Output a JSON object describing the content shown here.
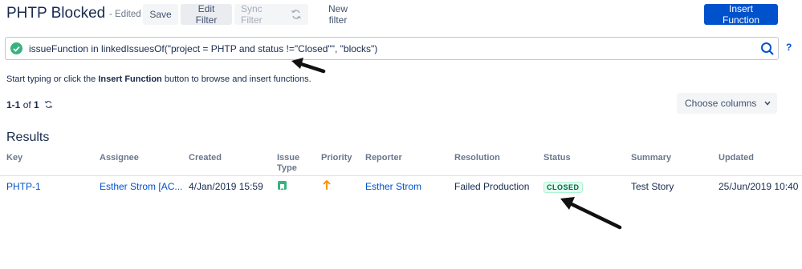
{
  "header": {
    "title": "PHTP Blocked",
    "edited": "- Edited",
    "save_label": "Save",
    "edit_filter_label": "Edit Filter",
    "sync_filter_label": "Sync Filter",
    "new_filter_label": "New filter",
    "insert_function_label": "Insert Function"
  },
  "query": {
    "value": "issueFunction in linkedIssuesOf(\"project = PHTP and status !=\"Closed\"\", \"blocks\")",
    "help": "?"
  },
  "hint": {
    "before": "Start typing or click the ",
    "bold": "Insert Function",
    "after": " button to browse and insert functions."
  },
  "pager": {
    "range": "1-1",
    "of": "of",
    "total": "1",
    "choose_columns_label": "Choose columns"
  },
  "results": {
    "title": "Results",
    "columns": [
      "Key",
      "Assignee",
      "Created",
      "Issue Type",
      "Priority",
      "Reporter",
      "Resolution",
      "Status",
      "Summary",
      "Updated"
    ],
    "rows": [
      {
        "key": "PHTP-1",
        "assignee": "Esther Strom [AC...",
        "created": "4/Jan/2019 15:59",
        "issue_type_icon": "story-icon",
        "priority_icon": "arrow-up-icon",
        "reporter": "Esther Strom",
        "resolution": "Failed Production",
        "status": "CLOSED",
        "summary": "Test Story",
        "updated": "25/Jun/2019 10:40"
      }
    ]
  },
  "colors": {
    "primary": "#0052cc",
    "success": "#36b37e",
    "priority": "#ff8b00",
    "status_closed_text": "#006644",
    "status_closed_bg": "#e3fcef"
  }
}
